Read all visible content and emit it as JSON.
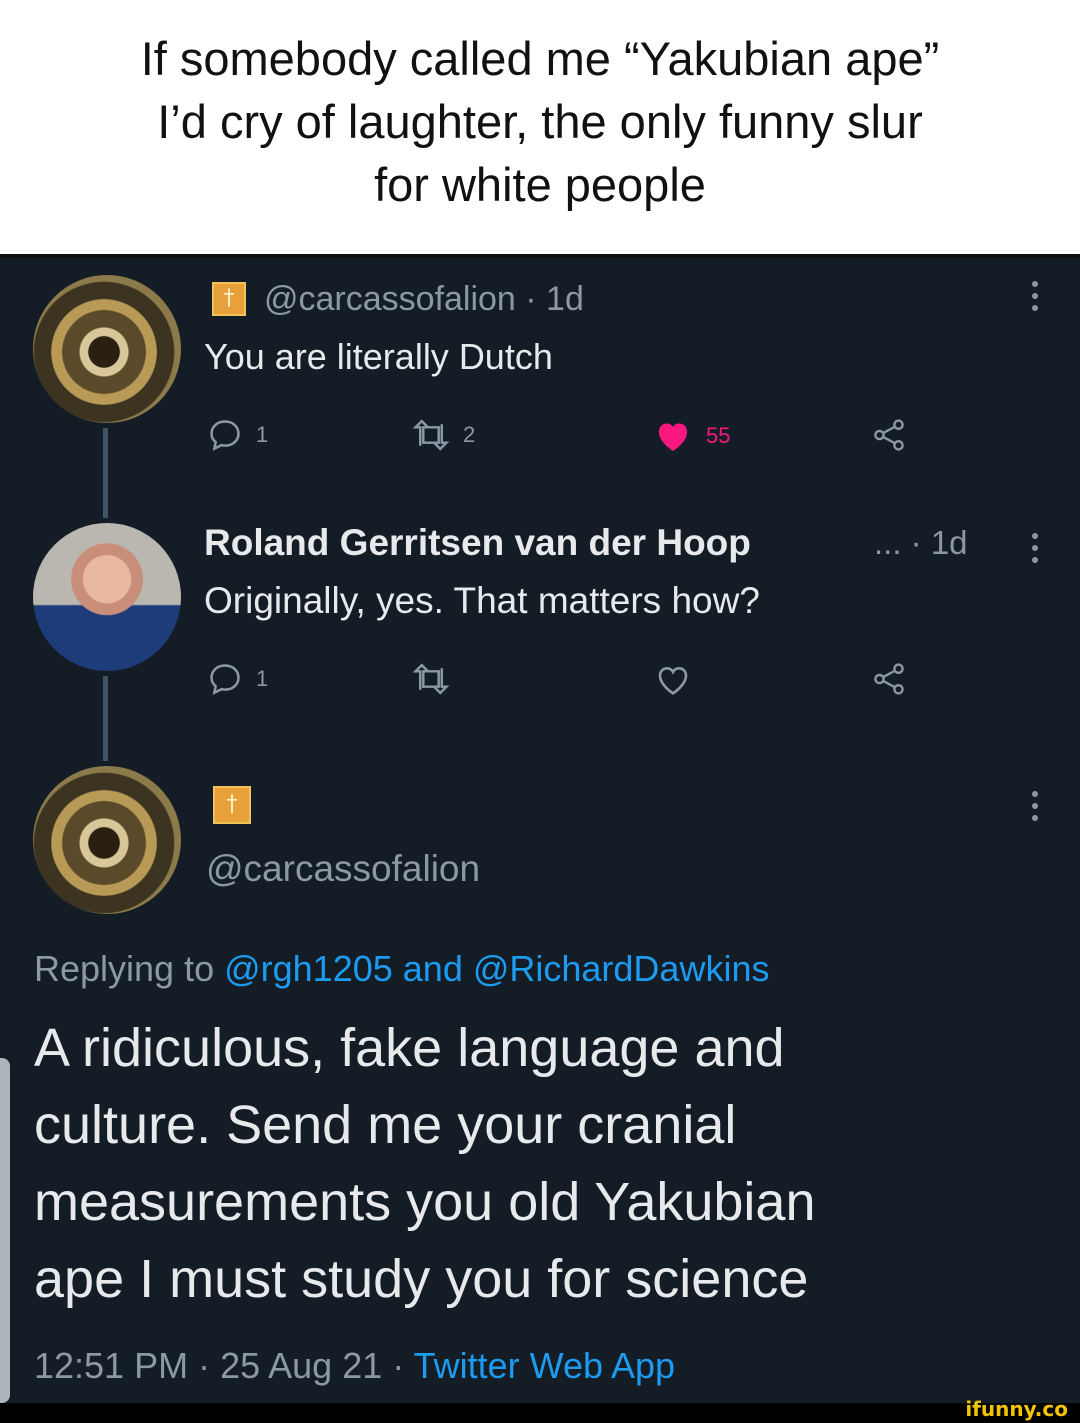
{
  "caption": {
    "lines": [
      "If somebody called me “Yakubian ape”",
      "I’d cry of laughter, the only funny slur",
      "for white people"
    ]
  },
  "tweet1": {
    "flag_glyph": "†",
    "handle_time": "@carcassofalion · 1d",
    "text": "You are literally Dutch",
    "replies": "1",
    "retweets": "2",
    "likes": "55",
    "liked": true,
    "like_color": "#f91880"
  },
  "tweet2": {
    "name": "Roland Gerritsen van der Hoop",
    "meta": "... · 1d",
    "text": "Originally, yes. That matters how?",
    "replies": "1"
  },
  "tweet3": {
    "flag_glyph": "†",
    "handle": "@carcassofalion",
    "replying_prefix": "Replying to ",
    "replying_users": "@rgh1205 and @RichardDawkins",
    "text_lines": [
      "A ridiculous, fake language and",
      "culture. Send me your cranial",
      "measurements you old Yakubian",
      "ape I must study you for science"
    ],
    "time_date": "12:51 PM · 25 Aug 21 · ",
    "client": "Twitter Web App"
  },
  "watermark": "ifunny.co",
  "colors": {
    "background": "#141d26",
    "text": "#e7e9ea",
    "muted": "#8b98a5",
    "link": "#1d9bf0",
    "like": "#f91880"
  },
  "icons": {
    "reply": "speech-bubble-icon",
    "retweet": "retweet-icon",
    "like": "heart-icon",
    "share": "share-icon",
    "more": "vertical-dots-icon"
  }
}
